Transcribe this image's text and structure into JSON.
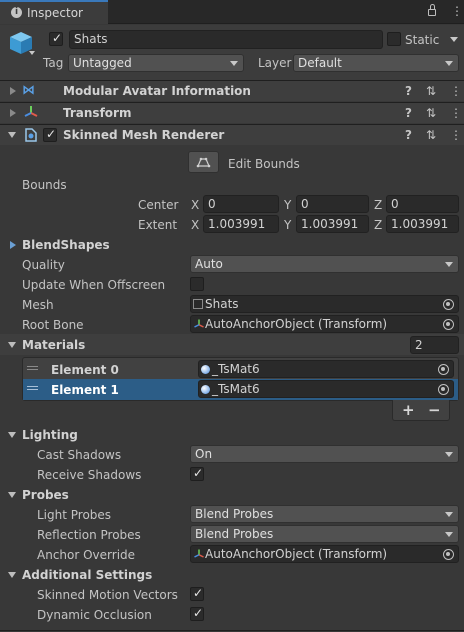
{
  "tab": {
    "title": "Inspector",
    "icon": "info-icon"
  },
  "gameobject": {
    "name": "Shats",
    "static_label": "Static",
    "tag_label": "Tag",
    "tag_value": "Untagged",
    "layer_label": "Layer",
    "layer_value": "Default"
  },
  "components": {
    "avatar": {
      "title": "Modular Avatar Information"
    },
    "transform": {
      "title": "Transform"
    },
    "smr": {
      "title": "Skinned Mesh Renderer"
    }
  },
  "smr": {
    "edit_bounds": "Edit Bounds",
    "bounds": {
      "label": "Bounds",
      "center_label": "Center",
      "extent_label": "Extent",
      "x": "X",
      "y": "Y",
      "z": "Z",
      "center": [
        "0",
        "0",
        "0"
      ],
      "extent": [
        "1.003991",
        "1.003991",
        "1.003991"
      ]
    },
    "blendshapes_label": "BlendShapes",
    "quality_label": "Quality",
    "quality_value": "Auto",
    "update_offscreen_label": "Update When Offscreen",
    "mesh_label": "Mesh",
    "mesh_value": "Shats",
    "rootbone_label": "Root Bone",
    "rootbone_value": "AutoAnchorObject (Transform)",
    "materials": {
      "label": "Materials",
      "count": "2",
      "elements": [
        {
          "label": "Element 0",
          "value": "_TsMat6"
        },
        {
          "label": "Element 1",
          "value": "_TsMat6"
        }
      ],
      "add": "+",
      "remove": "−"
    },
    "lighting_label": "Lighting",
    "cast_shadows_label": "Cast Shadows",
    "cast_shadows_value": "On",
    "receive_shadows_label": "Receive Shadows",
    "probes_label": "Probes",
    "light_probes_label": "Light Probes",
    "light_probes_value": "Blend Probes",
    "reflection_probes_label": "Reflection Probes",
    "reflection_probes_value": "Blend Probes",
    "anchor_override_label": "Anchor Override",
    "anchor_override_value": "AutoAnchorObject (Transform)",
    "additional_label": "Additional Settings",
    "skinned_motion_label": "Skinned Motion Vectors",
    "dynamic_occlusion_label": "Dynamic Occlusion"
  },
  "colors": {
    "selected_row": "#2c5d87",
    "background": "#383838",
    "header": "#3e3e3e"
  }
}
